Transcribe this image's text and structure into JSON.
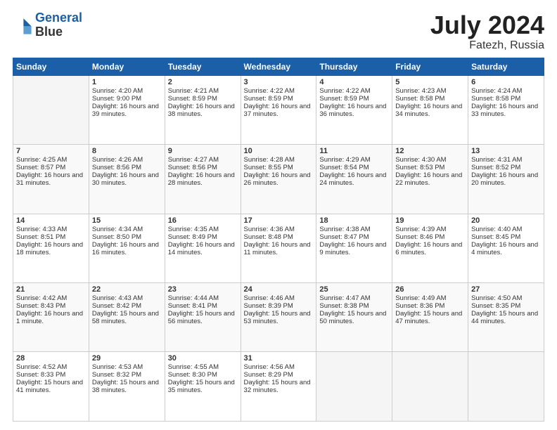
{
  "header": {
    "logo_line1": "General",
    "logo_line2": "Blue",
    "title": "July 2024",
    "location": "Fatezh, Russia"
  },
  "days_of_week": [
    "Sunday",
    "Monday",
    "Tuesday",
    "Wednesday",
    "Thursday",
    "Friday",
    "Saturday"
  ],
  "weeks": [
    [
      {
        "num": "",
        "sunrise": "",
        "sunset": "",
        "daylight": ""
      },
      {
        "num": "1",
        "sunrise": "Sunrise: 4:20 AM",
        "sunset": "Sunset: 9:00 PM",
        "daylight": "Daylight: 16 hours and 39 minutes."
      },
      {
        "num": "2",
        "sunrise": "Sunrise: 4:21 AM",
        "sunset": "Sunset: 8:59 PM",
        "daylight": "Daylight: 16 hours and 38 minutes."
      },
      {
        "num": "3",
        "sunrise": "Sunrise: 4:22 AM",
        "sunset": "Sunset: 8:59 PM",
        "daylight": "Daylight: 16 hours and 37 minutes."
      },
      {
        "num": "4",
        "sunrise": "Sunrise: 4:22 AM",
        "sunset": "Sunset: 8:59 PM",
        "daylight": "Daylight: 16 hours and 36 minutes."
      },
      {
        "num": "5",
        "sunrise": "Sunrise: 4:23 AM",
        "sunset": "Sunset: 8:58 PM",
        "daylight": "Daylight: 16 hours and 34 minutes."
      },
      {
        "num": "6",
        "sunrise": "Sunrise: 4:24 AM",
        "sunset": "Sunset: 8:58 PM",
        "daylight": "Daylight: 16 hours and 33 minutes."
      }
    ],
    [
      {
        "num": "7",
        "sunrise": "Sunrise: 4:25 AM",
        "sunset": "Sunset: 8:57 PM",
        "daylight": "Daylight: 16 hours and 31 minutes."
      },
      {
        "num": "8",
        "sunrise": "Sunrise: 4:26 AM",
        "sunset": "Sunset: 8:56 PM",
        "daylight": "Daylight: 16 hours and 30 minutes."
      },
      {
        "num": "9",
        "sunrise": "Sunrise: 4:27 AM",
        "sunset": "Sunset: 8:56 PM",
        "daylight": "Daylight: 16 hours and 28 minutes."
      },
      {
        "num": "10",
        "sunrise": "Sunrise: 4:28 AM",
        "sunset": "Sunset: 8:55 PM",
        "daylight": "Daylight: 16 hours and 26 minutes."
      },
      {
        "num": "11",
        "sunrise": "Sunrise: 4:29 AM",
        "sunset": "Sunset: 8:54 PM",
        "daylight": "Daylight: 16 hours and 24 minutes."
      },
      {
        "num": "12",
        "sunrise": "Sunrise: 4:30 AM",
        "sunset": "Sunset: 8:53 PM",
        "daylight": "Daylight: 16 hours and 22 minutes."
      },
      {
        "num": "13",
        "sunrise": "Sunrise: 4:31 AM",
        "sunset": "Sunset: 8:52 PM",
        "daylight": "Daylight: 16 hours and 20 minutes."
      }
    ],
    [
      {
        "num": "14",
        "sunrise": "Sunrise: 4:33 AM",
        "sunset": "Sunset: 8:51 PM",
        "daylight": "Daylight: 16 hours and 18 minutes."
      },
      {
        "num": "15",
        "sunrise": "Sunrise: 4:34 AM",
        "sunset": "Sunset: 8:50 PM",
        "daylight": "Daylight: 16 hours and 16 minutes."
      },
      {
        "num": "16",
        "sunrise": "Sunrise: 4:35 AM",
        "sunset": "Sunset: 8:49 PM",
        "daylight": "Daylight: 16 hours and 14 minutes."
      },
      {
        "num": "17",
        "sunrise": "Sunrise: 4:36 AM",
        "sunset": "Sunset: 8:48 PM",
        "daylight": "Daylight: 16 hours and 11 minutes."
      },
      {
        "num": "18",
        "sunrise": "Sunrise: 4:38 AM",
        "sunset": "Sunset: 8:47 PM",
        "daylight": "Daylight: 16 hours and 9 minutes."
      },
      {
        "num": "19",
        "sunrise": "Sunrise: 4:39 AM",
        "sunset": "Sunset: 8:46 PM",
        "daylight": "Daylight: 16 hours and 6 minutes."
      },
      {
        "num": "20",
        "sunrise": "Sunrise: 4:40 AM",
        "sunset": "Sunset: 8:45 PM",
        "daylight": "Daylight: 16 hours and 4 minutes."
      }
    ],
    [
      {
        "num": "21",
        "sunrise": "Sunrise: 4:42 AM",
        "sunset": "Sunset: 8:43 PM",
        "daylight": "Daylight: 16 hours and 1 minute."
      },
      {
        "num": "22",
        "sunrise": "Sunrise: 4:43 AM",
        "sunset": "Sunset: 8:42 PM",
        "daylight": "Daylight: 15 hours and 58 minutes."
      },
      {
        "num": "23",
        "sunrise": "Sunrise: 4:44 AM",
        "sunset": "Sunset: 8:41 PM",
        "daylight": "Daylight: 15 hours and 56 minutes."
      },
      {
        "num": "24",
        "sunrise": "Sunrise: 4:46 AM",
        "sunset": "Sunset: 8:39 PM",
        "daylight": "Daylight: 15 hours and 53 minutes."
      },
      {
        "num": "25",
        "sunrise": "Sunrise: 4:47 AM",
        "sunset": "Sunset: 8:38 PM",
        "daylight": "Daylight: 15 hours and 50 minutes."
      },
      {
        "num": "26",
        "sunrise": "Sunrise: 4:49 AM",
        "sunset": "Sunset: 8:36 PM",
        "daylight": "Daylight: 15 hours and 47 minutes."
      },
      {
        "num": "27",
        "sunrise": "Sunrise: 4:50 AM",
        "sunset": "Sunset: 8:35 PM",
        "daylight": "Daylight: 15 hours and 44 minutes."
      }
    ],
    [
      {
        "num": "28",
        "sunrise": "Sunrise: 4:52 AM",
        "sunset": "Sunset: 8:33 PM",
        "daylight": "Daylight: 15 hours and 41 minutes."
      },
      {
        "num": "29",
        "sunrise": "Sunrise: 4:53 AM",
        "sunset": "Sunset: 8:32 PM",
        "daylight": "Daylight: 15 hours and 38 minutes."
      },
      {
        "num": "30",
        "sunrise": "Sunrise: 4:55 AM",
        "sunset": "Sunset: 8:30 PM",
        "daylight": "Daylight: 15 hours and 35 minutes."
      },
      {
        "num": "31",
        "sunrise": "Sunrise: 4:56 AM",
        "sunset": "Sunset: 8:29 PM",
        "daylight": "Daylight: 15 hours and 32 minutes."
      },
      {
        "num": "",
        "sunrise": "",
        "sunset": "",
        "daylight": ""
      },
      {
        "num": "",
        "sunrise": "",
        "sunset": "",
        "daylight": ""
      },
      {
        "num": "",
        "sunrise": "",
        "sunset": "",
        "daylight": ""
      }
    ]
  ]
}
